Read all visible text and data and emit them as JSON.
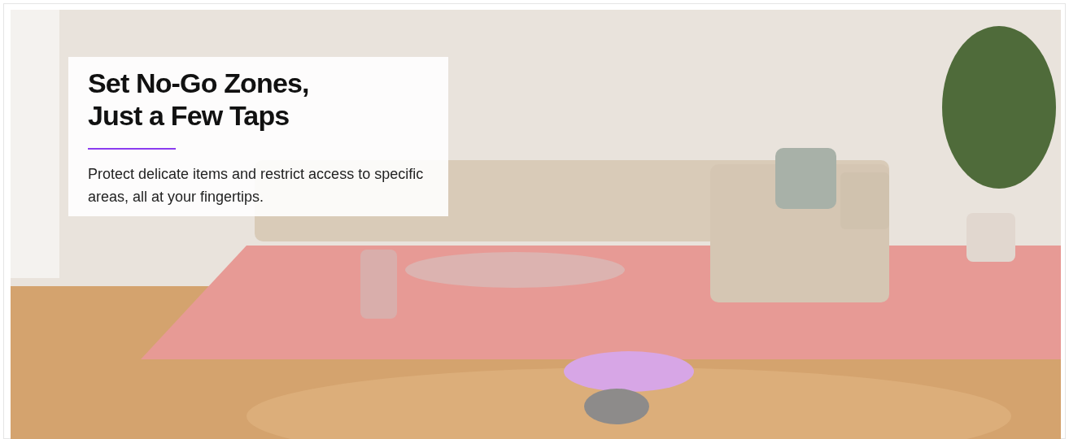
{
  "banner": {
    "card": {
      "title_lines": [
        "Set No-Go Zones,",
        "Just a Few Taps"
      ],
      "description": "Protect delicate items and restrict access to specific areas, all at your fingertips."
    }
  }
}
